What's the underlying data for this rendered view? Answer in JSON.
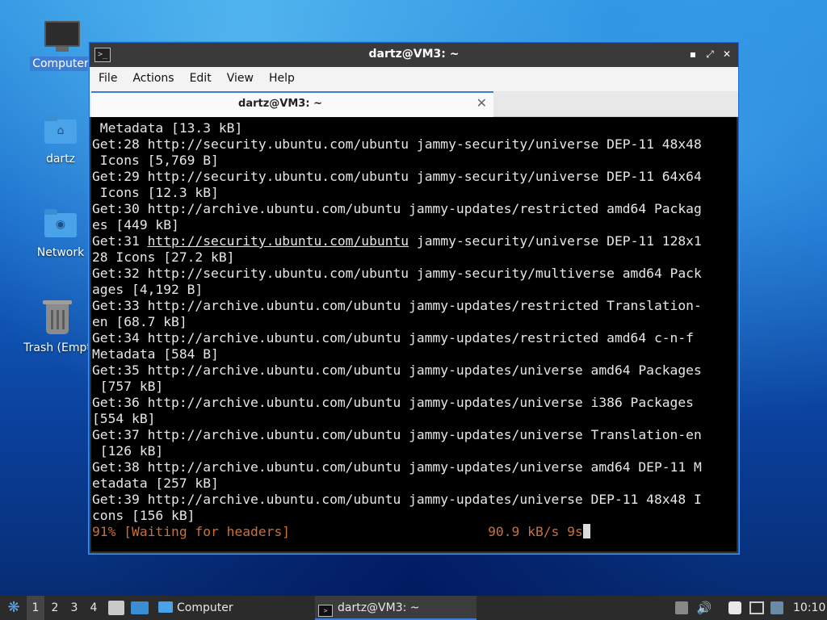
{
  "desktop": {
    "icons": [
      {
        "label": "Computer"
      },
      {
        "label": "dartz"
      },
      {
        "label": "Network"
      },
      {
        "label": "Trash (Empt"
      }
    ]
  },
  "window": {
    "title": "dartz@VM3: ~",
    "icon": "terminal-icon",
    "controls": {
      "minimize": "▪",
      "maximize": "⤢",
      "close": "✕"
    },
    "menu": [
      "File",
      "Actions",
      "Edit",
      "View",
      "Help"
    ],
    "tab": {
      "label": "dartz@VM3: ~",
      "close": "✕"
    },
    "terminal": {
      "lines": [
        " Metadata [13.3 kB]",
        "Get:28 http://security.ubuntu.com/ubuntu jammy-security/universe DEP-11 48x48",
        " Icons [5,769 B]",
        "Get:29 http://security.ubuntu.com/ubuntu jammy-security/universe DEP-11 64x64",
        " Icons [12.3 kB]",
        "Get:30 http://archive.ubuntu.com/ubuntu jammy-updates/restricted amd64 Packag",
        "es [449 kB]"
      ],
      "link_line_prefix": "Get:31 ",
      "link_text": "http://security.ubuntu.com/ubuntu",
      "link_line_suffix": " jammy-security/universe DEP-11 128x1",
      "lines2": [
        "28 Icons [27.2 kB]",
        "Get:32 http://security.ubuntu.com/ubuntu jammy-security/multiverse amd64 Pack",
        "ages [4,192 B]",
        "Get:33 http://archive.ubuntu.com/ubuntu jammy-updates/restricted Translation-",
        "en [68.7 kB]",
        "Get:34 http://archive.ubuntu.com/ubuntu jammy-updates/restricted amd64 c-n-f",
        "Metadata [584 B]",
        "Get:35 http://archive.ubuntu.com/ubuntu jammy-updates/universe amd64 Packages",
        " [757 kB]",
        "Get:36 http://archive.ubuntu.com/ubuntu jammy-updates/universe i386 Packages",
        "[554 kB]",
        "Get:37 http://archive.ubuntu.com/ubuntu jammy-updates/universe Translation-en",
        " [126 kB]",
        "Get:38 http://archive.ubuntu.com/ubuntu jammy-updates/universe amd64 DEP-11 M",
        "etadata [257 kB]",
        "Get:39 http://archive.ubuntu.com/ubuntu jammy-updates/universe DEP-11 48x48 I",
        "cons [156 kB]"
      ],
      "status_left": "91% [Waiting for headers]",
      "status_right": "90.9 kB/s 9s"
    }
  },
  "taskbar": {
    "workspaces": [
      "1",
      "2",
      "3",
      "4"
    ],
    "tasks": [
      {
        "label": "Computer"
      },
      {
        "label": "dartz@VM3: ~"
      }
    ],
    "clock": "10:10"
  },
  "colors": {
    "accent": "#3d7dd6",
    "status_text": "#c8713a",
    "terminal_bg": "#000000"
  }
}
